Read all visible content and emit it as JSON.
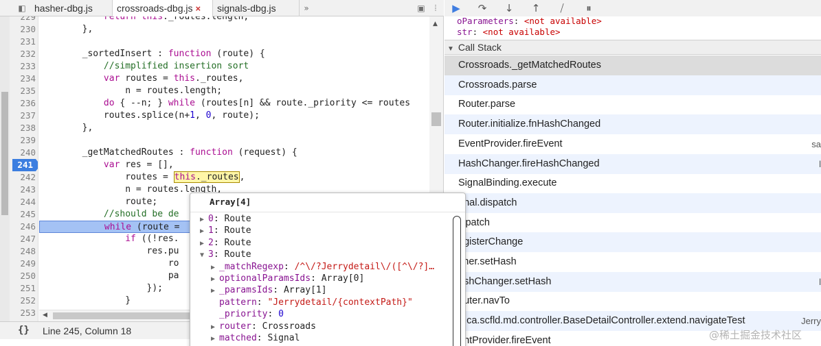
{
  "tabs": [
    {
      "label": "hasher-dbg.js",
      "active": false
    },
    {
      "label": "crossroads-dbg.js",
      "active": true
    },
    {
      "label": "signals-dbg.js",
      "active": false
    }
  ],
  "tab_close_glyph": "×",
  "tab_overflow_glyph": "»",
  "code_lines": [
    {
      "num": "229",
      "html": "            <span class=\"kw\">return</span> <span class=\"kw\">this</span>._routes.length;"
    },
    {
      "num": "230",
      "html": "        },"
    },
    {
      "num": "231",
      "html": ""
    },
    {
      "num": "232",
      "html": "        _sortedInsert : <span class=\"kw\">function</span> (route) {"
    },
    {
      "num": "233",
      "html": "            <span class=\"cm\">//simplified insertion sort</span>"
    },
    {
      "num": "234",
      "html": "            <span class=\"kw\">var</span> routes = <span class=\"kw\">this</span>._routes,"
    },
    {
      "num": "235",
      "html": "                n = routes.length;"
    },
    {
      "num": "236",
      "html": "            <span class=\"kw\">do</span> { --n; } <span class=\"kw\">while</span> (routes[n] &amp;&amp; route._priority &lt;= routes"
    },
    {
      "num": "237",
      "html": "            routes.splice(n+<span class=\"nm\">1</span>, <span class=\"nm\">0</span>, route);"
    },
    {
      "num": "238",
      "html": "        },"
    },
    {
      "num": "239",
      "html": ""
    },
    {
      "num": "240",
      "html": "        _getMatchedRoutes : <span class=\"kw\">function</span> (request) {"
    },
    {
      "num": "241",
      "html": "            <span class=\"kw\">var</span> res = [],",
      "breakpoint": true
    },
    {
      "num": "242",
      "html": "                routes = <span class=\"hl\"><span class=\"kw\">this</span>._routes</span>,"
    },
    {
      "num": "243",
      "html": "                n = routes.length,"
    },
    {
      "num": "244",
      "html": "                route;"
    },
    {
      "num": "245",
      "html": "            <span class=\"cm\">//should be de</span>"
    },
    {
      "num": "246",
      "html": "            <span class=\"kw\">while</span> (route = ",
      "paused": true
    },
    {
      "num": "247",
      "html": "                <span class=\"kw\">if</span> ((!res."
    },
    {
      "num": "248",
      "html": "                    res.pu"
    },
    {
      "num": "249",
      "html": "                        ro"
    },
    {
      "num": "250",
      "html": "                        pa"
    },
    {
      "num": "251",
      "html": "                    });"
    },
    {
      "num": "252",
      "html": "                }"
    },
    {
      "num": "253",
      "html": ""
    }
  ],
  "status": {
    "brace": "{}",
    "text": "Line 245, Column 18"
  },
  "debugger_toolbar": [
    {
      "name": "resume-icon",
      "glyph": "▶"
    },
    {
      "name": "step-over-icon",
      "glyph": "↷"
    },
    {
      "name": "step-into-icon",
      "glyph": "↓"
    },
    {
      "name": "step-out-icon",
      "glyph": "↑"
    },
    {
      "name": "deactivate-breakpoints-icon",
      "glyph": "⧸"
    },
    {
      "name": "pause-on-exceptions-icon",
      "glyph": "⏸"
    }
  ],
  "scope": [
    {
      "name": "oParameters",
      "value": "<not available>"
    },
    {
      "name": "str",
      "value": "<not available>"
    }
  ],
  "call_stack": {
    "header": "Call Stack",
    "frames": [
      {
        "label": "Crossroads._getMatchedRoutes",
        "loc": "",
        "selected": true
      },
      {
        "label": "Crossroads.parse",
        "loc": ""
      },
      {
        "label": "Router.parse",
        "loc": ""
      },
      {
        "label": "Router.initialize.fnHashChanged",
        "loc": ""
      },
      {
        "label": "EventProvider.fireEvent",
        "loc": "sa"
      },
      {
        "label": "HashChanger.fireHashChanged",
        "loc": "l"
      },
      {
        "label": "SignalBinding.execute",
        "loc": ""
      },
      {
        "label": "gnal.dispatch",
        "loc": ""
      },
      {
        "label": "ispatch",
        "loc": ""
      },
      {
        "label": "egisterChange",
        "loc": ""
      },
      {
        "label": "sher.setHash",
        "loc": ""
      },
      {
        "label": "ashChanger.setHash",
        "loc": "l"
      },
      {
        "label": "outer.navTo",
        "loc": ""
      },
      {
        "label": "p.ca.scfld.md.controller.BaseDetailController.extend.navigateTest",
        "loc": "Jerry"
      },
      {
        "label": "entProvider.fireEvent",
        "loc": ""
      }
    ]
  },
  "popover": {
    "title": "Array[4]",
    "rows": [
      {
        "arrow": "▶",
        "key": "0",
        "sep": ": ",
        "value": "Route",
        "vclass": "pv",
        "indent": 0
      },
      {
        "arrow": "▶",
        "key": "1",
        "sep": ": ",
        "value": "Route",
        "vclass": "pv",
        "indent": 0
      },
      {
        "arrow": "▶",
        "key": "2",
        "sep": ": ",
        "value": "Route",
        "vclass": "pv",
        "indent": 0
      },
      {
        "arrow": "▼",
        "key": "3",
        "sep": ": ",
        "value": "Route",
        "vclass": "pv",
        "indent": 0
      },
      {
        "arrow": "▶",
        "key": "_matchRegexp",
        "sep": ": ",
        "value": "/^\\/?Jerrydetail\\/([^\\/?]…",
        "vclass": "ps",
        "indent": 1
      },
      {
        "arrow": "▶",
        "key": "optionalParamsIds",
        "sep": ": ",
        "value": "Array[0]",
        "vclass": "pv",
        "indent": 1
      },
      {
        "arrow": "▶",
        "key": "_paramsIds",
        "sep": ": ",
        "value": "Array[1]",
        "vclass": "pv",
        "indent": 1
      },
      {
        "arrow": "",
        "key": "pattern",
        "sep": ": ",
        "value": "\"Jerrydetail/{contextPath}\"",
        "vclass": "ps",
        "indent": 1
      },
      {
        "arrow": "",
        "key": "_priority",
        "sep": ": ",
        "value": "0",
        "vclass": "pn",
        "indent": 1
      },
      {
        "arrow": "▶",
        "key": "router",
        "sep": ": ",
        "value": "Crossroads",
        "vclass": "pv",
        "indent": 1
      },
      {
        "arrow": "▶",
        "key": "matched",
        "sep": ": ",
        "value": "Signal",
        "vclass": "pv",
        "indent": 1
      }
    ]
  },
  "watermark": "@稀土掘金技术社区"
}
